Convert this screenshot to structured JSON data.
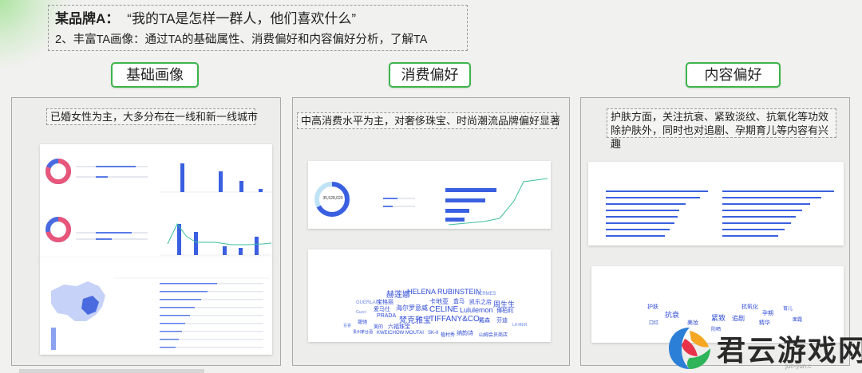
{
  "header": {
    "brand": "某品牌A：",
    "question": "“我的TA是怎样一群人，他们喜欢什么”",
    "subtitle": "2、丰富TA画像：通过TA的基础属性、消费偏好和内容偏好分析，了解TA"
  },
  "sections": [
    {
      "tag": "基础画像",
      "caption": "已婚女性为主，大多分布在一线和新一线城市"
    },
    {
      "tag": "消费偏好",
      "caption": "中高消费水平为主，对奢侈珠宝、时尚潮流品牌偏好显著"
    },
    {
      "tag": "内容偏好",
      "caption": "护肤方面，关注抗衰、紧致淡纹、抗氧化等功效除护肤外，同时也对追剧、孕期育儿等内容有兴趣"
    }
  ],
  "dashboard2": {
    "donut_value": "35,528,020",
    "word_cloud": [
      "赫莲娜",
      "HELENA RUBINSTEIN",
      "HERMES",
      "GUERLAIN",
      "宝格丽",
      "卡地亚",
      "盒马",
      "凯乐之店",
      "周生生",
      "爱马仕",
      "海尔",
      "罗意威",
      "CELINE",
      "Lululemon",
      "博柏利",
      "PRADA",
      "梵克雅宝",
      "TIFFANY&CO.",
      "戴森",
      "芬迪",
      "Gucci",
      "蔻驰",
      "美的",
      "六福珠宝",
      "喜宴",
      "KWEICHOW MOUTAI",
      "SK-II",
      "植村秀",
      "纳韵诗",
      "山姆会员商店",
      "贵州茅台酒",
      "LA MER"
    ]
  },
  "dashboard3": {
    "tags": [
      "护肤",
      "抗衰",
      "紧致",
      "抗氧化",
      "追剧",
      "孕期",
      "育儿",
      "美妆",
      "口红",
      "精华",
      "面霜",
      "防晒"
    ]
  },
  "watermark": {
    "text": "君云游戏网",
    "sub": "jun-yun.c",
    "colors": [
      "#2c7fd6",
      "#e8324a",
      "#f5a623",
      "#2fb45a"
    ]
  }
}
